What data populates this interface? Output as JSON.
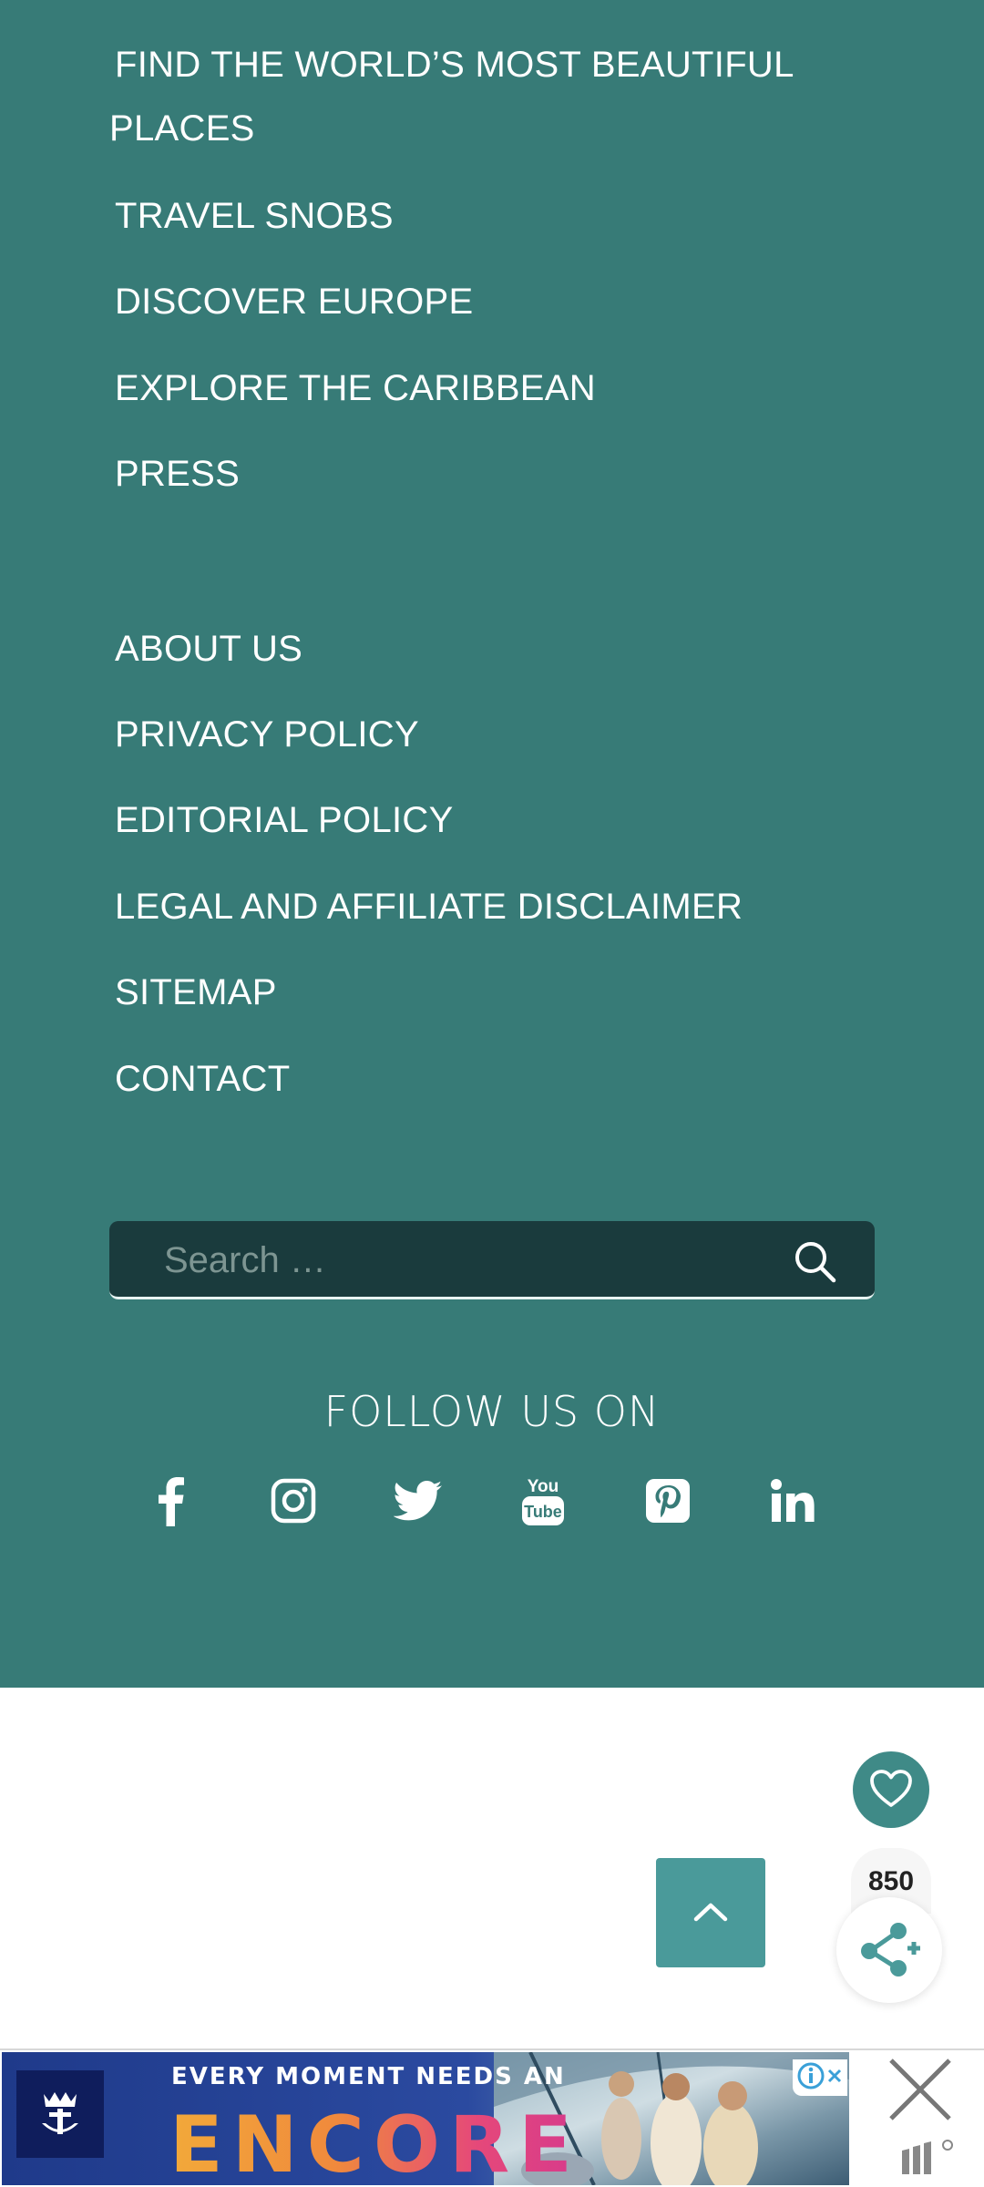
{
  "footer_menu": {
    "group1": [
      "FIND THE WORLD’S MOST BEAUTIFUL PLACES",
      "TRAVEL SNOBS",
      "DISCOVER EUROPE",
      "EXPLORE THE CARIBBEAN",
      "PRESS"
    ],
    "group2": [
      "ABOUT US",
      "PRIVACY POLICY",
      "EDITORIAL POLICY",
      "LEGAL AND AFFILIATE DISCLAIMER",
      "SITEMAP",
      "CONTACT"
    ]
  },
  "search": {
    "placeholder": "Search …",
    "icon": "search-icon"
  },
  "follow": {
    "heading": "FOLLOW US ON",
    "networks": [
      "facebook-icon",
      "instagram-icon",
      "twitter-icon",
      "youtube-icon",
      "pinterest-icon",
      "linkedin-icon"
    ]
  },
  "floating": {
    "heart_icon": "heart-icon",
    "share_count": "850",
    "share_icon": "share-icon",
    "scroll_top_icon": "chevron-up-icon"
  },
  "ad": {
    "tagline": "EVERY MOMENT NEEDS AN",
    "headline": "ENCORE",
    "logo": "royal-caribbean-crown-anchor-logo",
    "info_icon": "info-icon",
    "close_icon": "close-icon"
  },
  "colors": {
    "footer_bg": "#377b77",
    "search_bg": "#1a3b3d",
    "accent": "#4a9a9a",
    "text": "#ffffff"
  }
}
